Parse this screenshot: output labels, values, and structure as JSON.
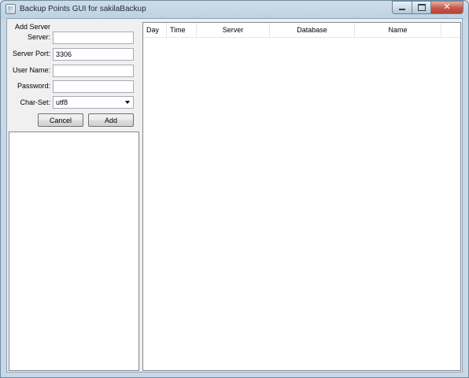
{
  "window": {
    "title": "Backup Points GUI for sakilaBackup",
    "icon": "app-window-icon",
    "controls": {
      "minimize": "minimize-icon",
      "maximize": "maximize-icon",
      "close": "close-icon",
      "close_glyph": "✕"
    }
  },
  "add_server": {
    "group_label": "Add Server",
    "fields": {
      "server": {
        "label": "Server:",
        "value": "",
        "placeholder": ""
      },
      "port": {
        "label": "Server Port:",
        "value": "3306",
        "placeholder": ""
      },
      "user": {
        "label": "User Name:",
        "value": "",
        "placeholder": ""
      },
      "password": {
        "label": "Password:",
        "value": "",
        "placeholder": ""
      },
      "charset": {
        "label": "Char-Set:",
        "value": "utf8"
      }
    },
    "buttons": {
      "cancel": "Cancel",
      "add": "Add"
    }
  },
  "backup_table": {
    "columns": [
      "Day",
      "Time",
      "Server",
      "Database",
      "Name"
    ],
    "rows": []
  },
  "server_list": {
    "items": []
  },
  "colors": {
    "titlebar": "#bfd2e2",
    "client_bg": "#f0f0f0",
    "close_button": "#c4584a"
  }
}
